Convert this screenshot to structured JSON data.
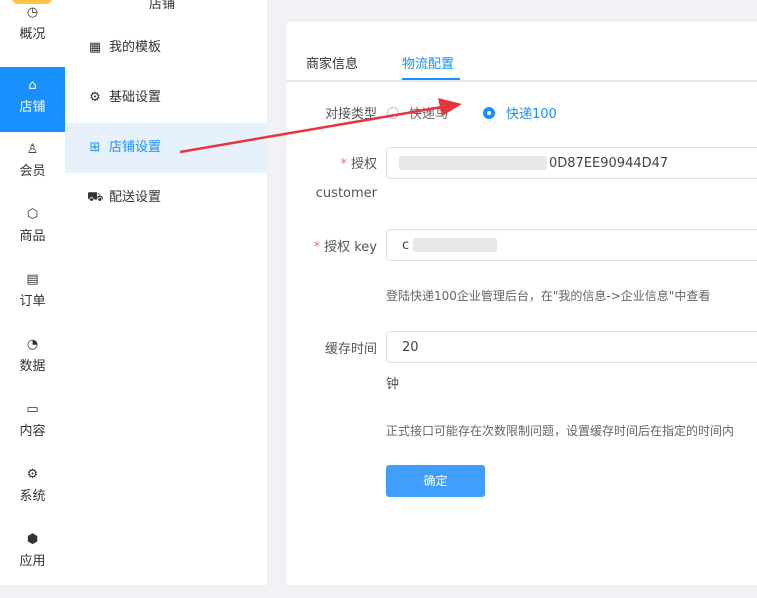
{
  "rail": {
    "items": [
      {
        "label": "概况",
        "icon": "dashboard-icon",
        "glyph": "◷"
      },
      {
        "label": "店铺",
        "icon": "store-icon",
        "glyph": "⌂"
      },
      {
        "label": "会员",
        "icon": "user-icon",
        "glyph": "♙"
      },
      {
        "label": "商品",
        "icon": "box-icon",
        "glyph": "⬡"
      },
      {
        "label": "订单",
        "icon": "clipboard-icon",
        "glyph": "▤"
      },
      {
        "label": "数据",
        "icon": "pie-chart-icon",
        "glyph": "◔"
      },
      {
        "label": "内容",
        "icon": "folder-icon",
        "glyph": "▭"
      },
      {
        "label": "系统",
        "icon": "gear-icon",
        "glyph": "⚙"
      },
      {
        "label": "应用",
        "icon": "cube-icon",
        "glyph": "⬢"
      }
    ]
  },
  "submenu": {
    "title": "店铺",
    "items": [
      {
        "label": "我的模板",
        "icon": "template-icon",
        "glyph": "▦"
      },
      {
        "label": "基础设置",
        "icon": "gear-icon",
        "glyph": "⚙"
      },
      {
        "label": "店铺设置",
        "icon": "store-settings-icon",
        "glyph": "⊞"
      },
      {
        "label": "配送设置",
        "icon": "truck-icon",
        "glyph": "⛟"
      }
    ]
  },
  "tabs": [
    "商家信息",
    "物流配置"
  ],
  "form": {
    "connect_type_label": "对接类型",
    "option1": "快递鸟",
    "option2": "快递100",
    "auth_customer_label_1": "授权",
    "auth_customer_label_2": "customer",
    "auth_customer_value": "0D87EE90944D47",
    "auth_key_label": "授权 key",
    "auth_key_value": "c",
    "key_hint": "登陆快递100企业管理后台，在\"我的信息->企业信息\"中查看",
    "cache_label": "缓存时间",
    "cache_value": "20",
    "cache_unit": "钟",
    "cache_hint": "正式接口可能存在次数限制问题，设置缓存时间后在指定的时间内",
    "confirm": "确定"
  },
  "colors": {
    "accent": "#1890ff",
    "button": "#409eff",
    "required": "#f56c6c",
    "arrow": "#e8343e"
  }
}
